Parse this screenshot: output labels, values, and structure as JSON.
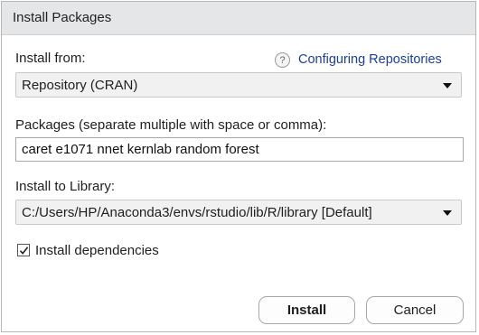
{
  "dialog": {
    "title": "Install Packages",
    "install_from": {
      "label": "Install from:",
      "help_icon": "question-icon",
      "help_link": "Configuring Repositories",
      "selected": "Repository (CRAN)"
    },
    "packages": {
      "label": "Packages (separate multiple with space or comma):",
      "value": "caret e1071 nnet kernlab random forest"
    },
    "library": {
      "label": "Install to Library:",
      "selected": "C:/Users/HP/Anaconda3/envs/rstudio/lib/R/library [Default]"
    },
    "dependencies": {
      "label": "Install dependencies",
      "checked": true
    },
    "buttons": {
      "install": "Install",
      "cancel": "Cancel"
    }
  }
}
